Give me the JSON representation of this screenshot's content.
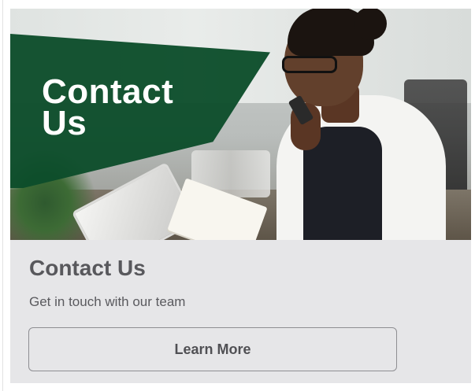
{
  "hero": {
    "title_line1": "Contact",
    "title_line2": "Us",
    "band_color": "#0d4d2b"
  },
  "card": {
    "title": "Contact Us",
    "subtitle": "Get in touch with our team",
    "cta_label": "Learn More",
    "background_color": "#e6e6e8"
  }
}
